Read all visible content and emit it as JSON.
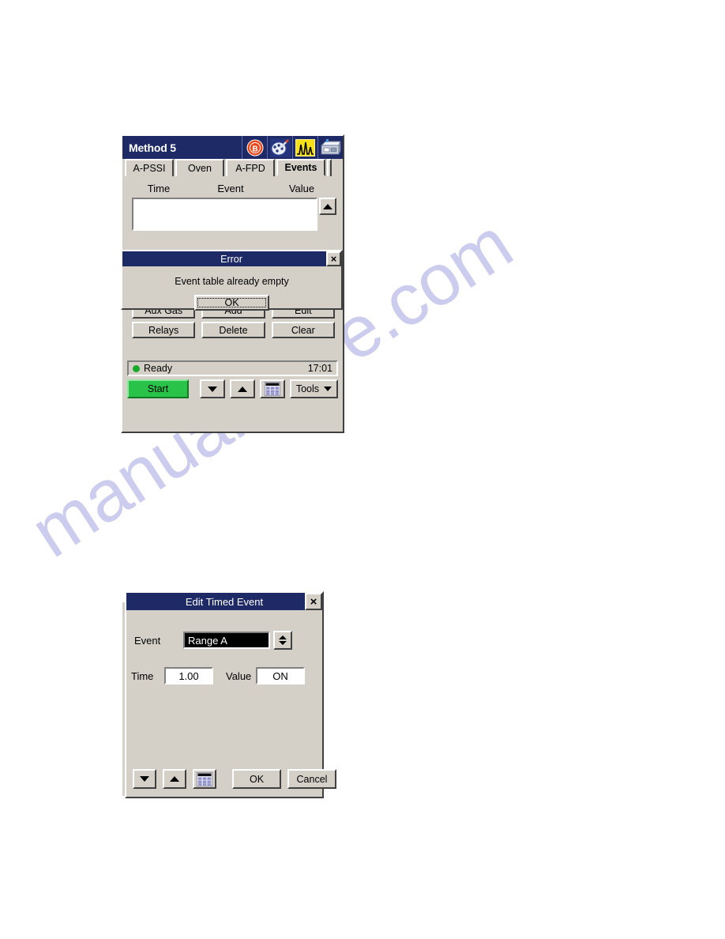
{
  "watermark": {
    "text": "manualshive.com"
  },
  "main_window": {
    "title": "Method 5",
    "titlebar_color": "#1d2a66",
    "icons": [
      {
        "name": "bruker-b-logo-icon",
        "label": "B"
      },
      {
        "name": "palette-tool-icon",
        "label": ""
      },
      {
        "name": "chromatogram-peaks-icon",
        "label": ""
      },
      {
        "name": "instrument-icon",
        "label": ""
      }
    ],
    "tabs": [
      {
        "label": "A-PSSI",
        "active": false
      },
      {
        "label": "Oven",
        "active": false
      },
      {
        "label": "A-FPD",
        "active": false
      },
      {
        "label": "Events",
        "active": true
      }
    ],
    "table": {
      "columns": [
        "Time",
        "Event",
        "Value"
      ],
      "rows": []
    },
    "error_dialog": {
      "title": "Error",
      "message": "Event table already empty",
      "ok_label": "OK",
      "close_label": "×"
    },
    "buttons": [
      {
        "label": "Aux Gas",
        "name": "aux-gas-button"
      },
      {
        "label": "Add",
        "name": "add-button"
      },
      {
        "label": "Edit",
        "name": "edit-button"
      },
      {
        "label": "Relays",
        "name": "relays-button"
      },
      {
        "label": "Delete",
        "name": "delete-button"
      },
      {
        "label": "Clear",
        "name": "clear-button"
      }
    ],
    "status": {
      "state": "Ready",
      "led_color": "#17aa28",
      "time": "17:01"
    },
    "toolbar": {
      "start_label": "Start",
      "start_color": "#29c34a",
      "tools_label": "Tools"
    }
  },
  "edit_dialog": {
    "title": "Edit Timed Event",
    "close_label": "×",
    "event_label": "Event",
    "event_value": "Range A",
    "time_label": "Time",
    "time_value": "1.00",
    "value_label": "Value",
    "value_value": "ON",
    "ok_label": "OK",
    "cancel_label": "Cancel"
  }
}
